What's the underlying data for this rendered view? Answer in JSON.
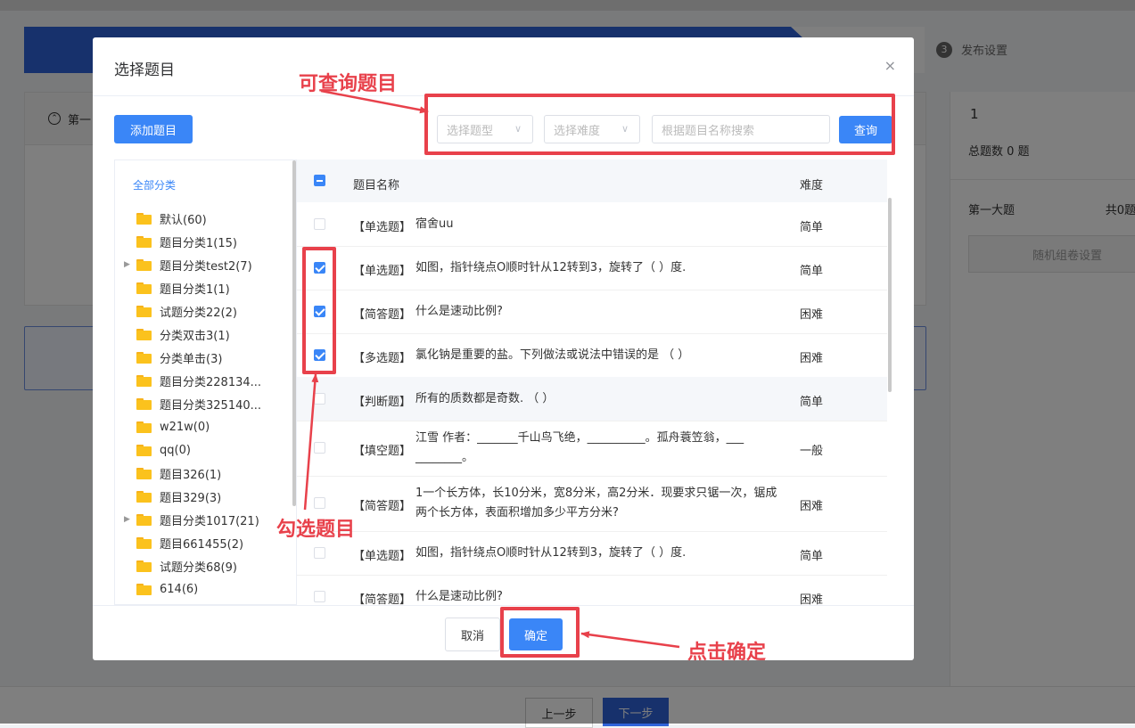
{
  "background": {
    "step3": {
      "num": "3",
      "label": "发布设置"
    },
    "section_label": "第一",
    "right_panel": {
      "num": "1",
      "total": "总题数 0 题",
      "section": "第一大题",
      "count": "共0题",
      "button": "随机组卷设置"
    },
    "prev_button": "上一步",
    "next_button": "下一步"
  },
  "modal": {
    "title": "选择题目",
    "close_glyph": "×",
    "add_button": "添加题目",
    "type_select_placeholder": "选择题型",
    "difficulty_select_placeholder": "选择难度",
    "search_placeholder": "根据题目名称搜索",
    "query_button": "查询",
    "tree": {
      "all_label": "全部分类",
      "items": [
        {
          "label": "默认(60)",
          "has_children": false
        },
        {
          "label": "题目分类1(15)",
          "has_children": false
        },
        {
          "label": "题目分类test2(7)",
          "has_children": true
        },
        {
          "label": "题目分类1(1)",
          "has_children": false
        },
        {
          "label": "试题分类22(2)",
          "has_children": false
        },
        {
          "label": "分类双击3(1)",
          "has_children": false
        },
        {
          "label": "分类单击(3)",
          "has_children": false
        },
        {
          "label": "题目分类228134...",
          "has_children": false
        },
        {
          "label": "题目分类325140...",
          "has_children": false
        },
        {
          "label": "w21w(0)",
          "has_children": false
        },
        {
          "label": "qq(0)",
          "has_children": false
        },
        {
          "label": "题目326(1)",
          "has_children": false
        },
        {
          "label": "题目329(3)",
          "has_children": false
        },
        {
          "label": "题目分类1017(21)",
          "has_children": true
        },
        {
          "label": "题目661455(2)",
          "has_children": false
        },
        {
          "label": "试题分类68(9)",
          "has_children": false
        },
        {
          "label": "614(6)",
          "has_children": false
        }
      ]
    },
    "table": {
      "col_name": "题目名称",
      "col_difficulty": "难度",
      "rows": [
        {
          "type": "【单选题】",
          "text": "宿舍uu",
          "difficulty": "简单",
          "checked": false
        },
        {
          "type": "【单选题】",
          "text": "如图，指针绕点O顺时针从12转到3，旋转了（ ）度.",
          "difficulty": "简单",
          "checked": true
        },
        {
          "type": "【简答题】",
          "text": "什么是速动比例?",
          "difficulty": "困难",
          "checked": true
        },
        {
          "type": "【多选题】",
          "text": "氯化钠是重要的盐。下列做法或说法中错误的是 （ ）",
          "difficulty": "困难",
          "checked": true
        },
        {
          "type": "【判断题】",
          "text": "所有的质数都是奇数. （ ）",
          "difficulty": "简单",
          "checked": false
        },
        {
          "type": "【填空题】",
          "text": "江雪 作者：_______千山鸟飞绝，__________。孤舟蓑笠翁，___ ________。",
          "difficulty": "一般",
          "checked": false
        },
        {
          "type": "【简答题】",
          "text": "1一个长方体，长10分米，宽8分米，高2分米．现要求只锯一次，锯成两个长方体，表面积增加多少平方分米?",
          "difficulty": "困难",
          "checked": false
        },
        {
          "type": "【单选题】",
          "text": "如图，指针绕点O顺时针从12转到3，旋转了（ ）度.",
          "difficulty": "简单",
          "checked": false
        },
        {
          "type": "【简答题】",
          "text": "什么是速动比例?",
          "difficulty": "困难",
          "checked": false
        }
      ]
    },
    "cancel_button": "取消",
    "confirm_button": "确定"
  },
  "annotations": {
    "query_hint": "可查询题目",
    "check_hint": "勾选题目",
    "confirm_hint": "点击确定",
    "color": "#e8414b"
  },
  "colors": {
    "primary": "#3a86f7",
    "step_active": "#2f63d9",
    "folder": "#fbc21d"
  }
}
